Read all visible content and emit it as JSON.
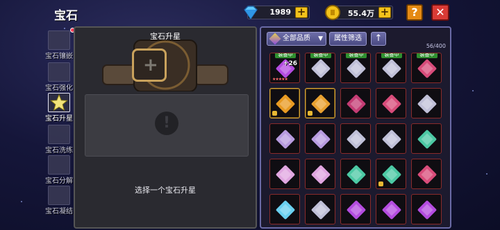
{
  "header": {
    "title": "宝石",
    "diamonds": "1989",
    "gold": "55.4万",
    "help_label": "?",
    "close_label": "✕",
    "plus_label": "+"
  },
  "sidebar": {
    "items": [
      {
        "label": "宝石镶嵌",
        "icon": "gem-inlay-icon",
        "active": false,
        "badge": true
      },
      {
        "label": "宝石强化",
        "icon": "gem-enhance-icon",
        "active": false
      },
      {
        "label": "宝石升星",
        "icon": "star-upgrade-icon",
        "active": true
      },
      {
        "label": "宝石洗练",
        "icon": "gem-refine-icon",
        "active": false
      },
      {
        "label": "宝石分解",
        "icon": "gem-decompose-icon",
        "active": false
      },
      {
        "label": "宝石凝结",
        "icon": "gem-condense-icon",
        "active": false
      }
    ]
  },
  "center": {
    "title": "宝石升星",
    "slot_icon": "+",
    "warn_icon": "!",
    "hint": "选择一个宝石升星"
  },
  "inventory": {
    "quality_label": "全部品质",
    "filter_label": "属性筛选",
    "sort_label": "↑",
    "count": "56/400",
    "equipped_label": "装备中",
    "featured_level": "+26",
    "cells": [
      {
        "equipped": true,
        "color": "#b44ce0",
        "level": "+26",
        "stars": true
      },
      {
        "equipped": true,
        "color": "#c0c0d8"
      },
      {
        "equipped": true,
        "color": "#c0c0d8"
      },
      {
        "equipped": true,
        "color": "#c0c0d8"
      },
      {
        "equipped": true,
        "color": "#d84c7a"
      },
      {
        "equipped": false,
        "color": "#e89a22",
        "gold": true,
        "lock": true
      },
      {
        "equipped": false,
        "color": "#e8a030",
        "gold": true,
        "lock": true
      },
      {
        "equipped": false,
        "color": "#c43c74"
      },
      {
        "equipped": false,
        "color": "#d84c7a"
      },
      {
        "equipped": false,
        "color": "#c0c0d8"
      },
      {
        "equipped": false,
        "color": "#b89ce0"
      },
      {
        "equipped": false,
        "color": "#b89ce0"
      },
      {
        "equipped": false,
        "color": "#c0c0d8"
      },
      {
        "equipped": false,
        "color": "#c0c0d8"
      },
      {
        "equipped": false,
        "color": "#4cc9a4"
      },
      {
        "equipped": false,
        "color": "#e0a6e0"
      },
      {
        "equipped": false,
        "color": "#e0a6e0"
      },
      {
        "equipped": false,
        "color": "#4cc9a4"
      },
      {
        "equipped": false,
        "color": "#4cc9a4",
        "lock": true
      },
      {
        "equipped": false,
        "color": "#d84c7a"
      },
      {
        "equipped": false,
        "color": "#6ad0f0"
      },
      {
        "equipped": false,
        "color": "#c0c0d8"
      },
      {
        "equipped": false,
        "color": "#b44ce0"
      },
      {
        "equipped": false,
        "color": "#b44ce0"
      },
      {
        "equipped": false,
        "color": "#b44ce0"
      }
    ]
  },
  "colors": {
    "accent_gold": "#f2c21b",
    "close_red": "#d93b36",
    "help_orange": "#e58a14",
    "panel_border": "#6a6aa6",
    "equip_green": "#2f8f2f"
  }
}
